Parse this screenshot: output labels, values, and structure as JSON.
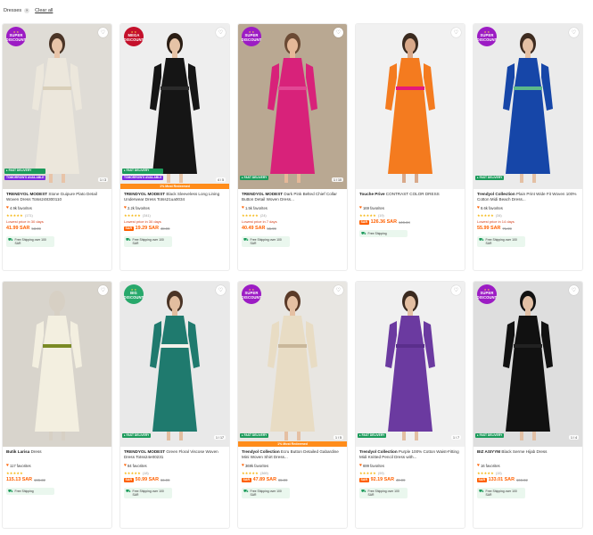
{
  "filters": {
    "chip_label": "Dresses",
    "chip_remove": "×",
    "clear_all": "Clear all"
  },
  "colors": {
    "accent": "#ff6000",
    "fast_delivery": "#1c9b5b",
    "tomorrow": "#7a2ae0",
    "super_badge": "#9c1cc4",
    "mega_badge": "#c4102b",
    "big_badge": "#27a86b"
  },
  "products": [
    {
      "badge": {
        "type": "super",
        "line1": "SUPER",
        "line2": "DISCOUNT"
      },
      "image": {
        "bg": "#dfdcd6",
        "figure": "#ece7dc",
        "accent": "#d9cfb9",
        "skin": "#e8c4a8",
        "hair": "#4a3426"
      },
      "tags": [
        "FAST DELIVERY",
        "TOMORROW'S AVAILABLE"
      ],
      "promo_strip": "",
      "counter": "1 / 3",
      "brand": "TRENDYOL MODEST",
      "name": "Stone Guipure Plato Detail Woven Dress Totss248300110",
      "favorites": "4.9k favorites",
      "rating_count": "(171)",
      "lowest": "Lowest price in 30 days",
      "price_tag": "",
      "price": "41.99 SAR",
      "old_price": "53.99",
      "shipping": "Free Shipping over 100 SAR"
    },
    {
      "badge": {
        "type": "mega",
        "line1": "MEGA",
        "line2": "DISCOUNT"
      },
      "image": {
        "bg": "#eeeeee",
        "figure": "#151515",
        "accent": "#2a2a2a",
        "skin": "#e6c3a6",
        "hair": "#2a1d14"
      },
      "tags": [
        "FAST DELIVERY",
        "TOMORROW'S AVAILABLE"
      ],
      "promo_strip": "1% Most Redeemed",
      "counter": "4 / 5",
      "brand": "TRENDYOL MODEST",
      "name": "Black Sleeveless Long Lining Underwear Dress Totss21ua0034",
      "favorites": "2.2k favorites",
      "rating_count": "(341)",
      "lowest": "Lowest price in 30 days",
      "price_tag": "SAR",
      "price": "19.29 SAR",
      "old_price": "48.99",
      "shipping": "Free Shipping over 100 SAR"
    },
    {
      "badge": {
        "type": "super",
        "line1": "SUPER",
        "line2": "DISCOUNT"
      },
      "image": {
        "bg": "#b9a892",
        "figure": "#d8227a",
        "accent": "#e24895",
        "skin": "#e5b898",
        "hair": "#6b4a34"
      },
      "tags": [
        "FAST DELIVERY"
      ],
      "promo_strip": "",
      "counter": "1 / 10",
      "brand": "TRENDYOL MODEST",
      "name": "Dark Pink Belted Chief Collar Button Detail Woven Dress...",
      "favorites": "1.5k favorites",
      "rating_count": "(24)",
      "lowest": "Lowest price in 7 days",
      "price_tag": "",
      "price": "40.49 SAR",
      "old_price": "55.99",
      "shipping": "Free Shipping over 100 SAR"
    },
    {
      "badge": null,
      "image": {
        "bg": "#f1f1f1",
        "figure": "#f47b1f",
        "accent": "#e5197a",
        "skin": "#d9a98a",
        "hair": "#3a2a1f"
      },
      "tags": [],
      "promo_strip": "",
      "counter": "",
      "brand": "Touche Prive",
      "name": "CONTRAST COLOR DRESS",
      "favorites": "169 favorites",
      "rating_count": "(19)",
      "lowest": "",
      "price_tag": "SAR",
      "price": "126.36 SAR",
      "old_price": "146.34",
      "shipping": "Free Shipping"
    },
    {
      "badge": {
        "type": "super",
        "line1": "SUPER",
        "line2": "DISCOUNT"
      },
      "image": {
        "bg": "#ebebeb",
        "figure": "#1646a8",
        "accent": "#5cb88a",
        "skin": "#e4c0a4",
        "hair": "#3d2b20"
      },
      "tags": [
        "FAST DELIVERY"
      ],
      "promo_strip": "",
      "counter": "",
      "brand": "Trendyol Collection",
      "name": "Plain Print Wide Fit Woven 100% Cotton Midi Beach Dress...",
      "favorites": "8.6k favorites",
      "rating_count": "(34)",
      "lowest": "Lowest price in 14 days",
      "price_tag": "",
      "price": "55.99 SAR",
      "old_price": "71.99",
      "shipping": "Free Shipping over 100 SAR"
    },
    {
      "badge": null,
      "image": {
        "bg": "#d8d4cc",
        "figure": "#f3efe0",
        "accent": "#7a8a24",
        "skin": "#d7d0c4",
        "hair": "#d7d0c4"
      },
      "tags": [],
      "promo_strip": "",
      "counter": "",
      "brand": "Butik Larisa",
      "name": "Dress",
      "favorites": "117 favorites",
      "rating_count": "",
      "lowest": "",
      "price_tag": "",
      "price": "115.13 SAR",
      "old_price": "165.22",
      "shipping": "Free Shipping"
    },
    {
      "badge": {
        "type": "big",
        "line1": "BIG",
        "line2": "DISCOUNT"
      },
      "image": {
        "bg": "#e9e9e9",
        "figure": "#1f7a6e",
        "accent": "#f4f1ea",
        "skin": "#e2bd9f",
        "hair": "#4a3426"
      },
      "tags": [
        "FAST DELIVERY"
      ],
      "promo_strip": "",
      "counter": "1 / 17",
      "brand": "TRENDYOL MODEST",
      "name": "Green Floral Viscose Woven Dress Totss24e00231",
      "favorites": "84 favorites",
      "rating_count": "(18)",
      "lowest": "",
      "price_tag": "SAR",
      "price": "50.99 SAR",
      "old_price": "66.99",
      "shipping": "Free Shipping over 100 SAR"
    },
    {
      "badge": {
        "type": "super",
        "line1": "SUPER",
        "line2": "DISCOUNT"
      },
      "image": {
        "bg": "#e8e6e2",
        "figure": "#e8dcc4",
        "accent": "#c9b79a",
        "skin": "#e5c0a3",
        "hair": "#5a3a28"
      },
      "tags": [
        "FAST DELIVERY"
      ],
      "promo_strip": "1% Most Redeemed",
      "counter": "1 / 5",
      "brand": "Trendyol Collection",
      "name": "Ecru Button Detailed Gabardine Mini Woven Shirt Dress...",
      "favorites": "369k favorites",
      "rating_count": "(369)",
      "lowest": "",
      "price_tag": "SAR",
      "price": "47.89 SAR",
      "old_price": "65.99",
      "shipping": "Free Shipping over 100 SAR"
    },
    {
      "badge": null,
      "image": {
        "bg": "#f0f0f0",
        "figure": "#6b3aa0",
        "accent": "#5a2e8c",
        "skin": "#e3bfa2",
        "hair": "#3a2a1f"
      },
      "tags": [
        "FAST DELIVERY"
      ],
      "promo_strip": "",
      "counter": "1 / 7",
      "brand": "Trendyol Collection",
      "name": "Purple 100% Cotton Waist-Fitting Midi Knitted Pencil Dress with...",
      "favorites": "699 favorites",
      "rating_count": "(99)",
      "lowest": "",
      "price_tag": "SAR",
      "price": "92.19 SAR",
      "old_price": "49.99",
      "shipping": "Free Shipping over 100 SAR"
    },
    {
      "badge": {
        "type": "super",
        "line1": "SUPER",
        "line2": "DISCOUNT"
      },
      "image": {
        "bg": "#dedede",
        "figure": "#111111",
        "accent": "#222222",
        "skin": "#e2c0a5",
        "hair": "#111111"
      },
      "tags": [
        "FAST DELIVERY"
      ],
      "promo_strip": "",
      "counter": "1 / 4",
      "brand": "BIZ ASIYYM",
      "name": "Black Serme Hijab Dress",
      "favorites": "16 favorites",
      "rating_count": "(15)",
      "lowest": "",
      "price_tag": "SAR",
      "price": "133.01 SAR",
      "old_price": "166.82",
      "shipping": "Free Shipping over 100 SAR"
    }
  ]
}
